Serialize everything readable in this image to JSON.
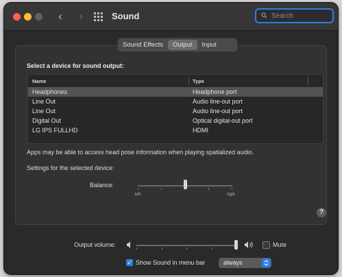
{
  "window": {
    "title": "Sound"
  },
  "search": {
    "placeholder": "Search",
    "value": ""
  },
  "tabs": [
    {
      "label": "Sound Effects",
      "active": false
    },
    {
      "label": "Output",
      "active": true
    },
    {
      "label": "Input",
      "active": false
    }
  ],
  "output": {
    "heading": "Select a device for sound output:",
    "columns": {
      "name": "Name",
      "type": "Type"
    },
    "devices": [
      {
        "name": "Headphones",
        "type": "Headphone port",
        "selected": true
      },
      {
        "name": "Line Out",
        "type": "Audio line-out port",
        "selected": false
      },
      {
        "name": "Line Out",
        "type": "Audio line-out port",
        "selected": false
      },
      {
        "name": "Digital Out",
        "type": "Optical digital-out port",
        "selected": false
      },
      {
        "name": "LG IPS FULLHD",
        "type": "HDMI",
        "selected": false
      }
    ],
    "note": "Apps may be able to access head pose information when playing spatialized audio.",
    "settings_label": "Settings for the selected device:",
    "balance": {
      "label": "Balance:",
      "left_label": "left",
      "right_label": "right",
      "value": 0.5
    },
    "help_glyph": "?"
  },
  "volume": {
    "label": "Output volume:",
    "level": 1.0,
    "mute_label": "Mute",
    "muted": false
  },
  "menu_bar": {
    "label": "Show Sound in menu bar",
    "checked": true,
    "option": "always"
  },
  "colors": {
    "accent": "#2f7de1",
    "close": "#ff5f57",
    "minimize": "#febc2e"
  }
}
